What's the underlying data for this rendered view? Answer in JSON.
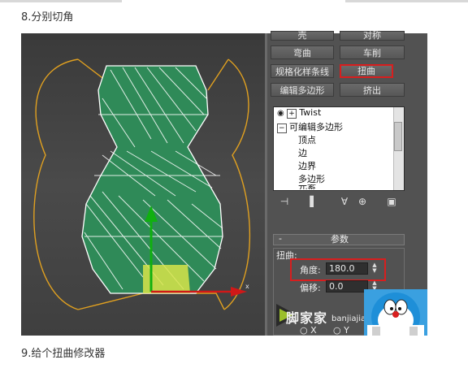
{
  "page": {
    "heading_top": "8.分别切角",
    "heading_bottom": "9.给个扭曲修改器"
  },
  "modifier_buttons": {
    "partial_left": "壳",
    "partial_right": "对称",
    "bend": "弯曲",
    "lathe": "车削",
    "normalize_spline": "规格化样条线",
    "twist": "扭曲",
    "edit_poly": "编辑多边形",
    "extrude": "挤出"
  },
  "modifier_stack": {
    "items": [
      "Twist",
      "可编辑多边形",
      "顶点",
      "边",
      "边界",
      "多边形",
      "元素"
    ]
  },
  "parameters": {
    "rollout_title": "参数",
    "twist_group_label": "扭曲:",
    "angle_label": "角度:",
    "angle_value": "180.0",
    "bias_label": "偏移:",
    "bias_value": "0.0",
    "axis_x": "X",
    "axis_y": "Y"
  },
  "watermark": {
    "brand": "脚家家",
    "sub": "banjiajia"
  },
  "colors": {
    "highlight": "#d81e1e",
    "mesh": "#3fa868",
    "wire": "#ffffff",
    "bbox": "#e0a020",
    "axis_x": "#d01818",
    "axis_y": "#10b010"
  }
}
